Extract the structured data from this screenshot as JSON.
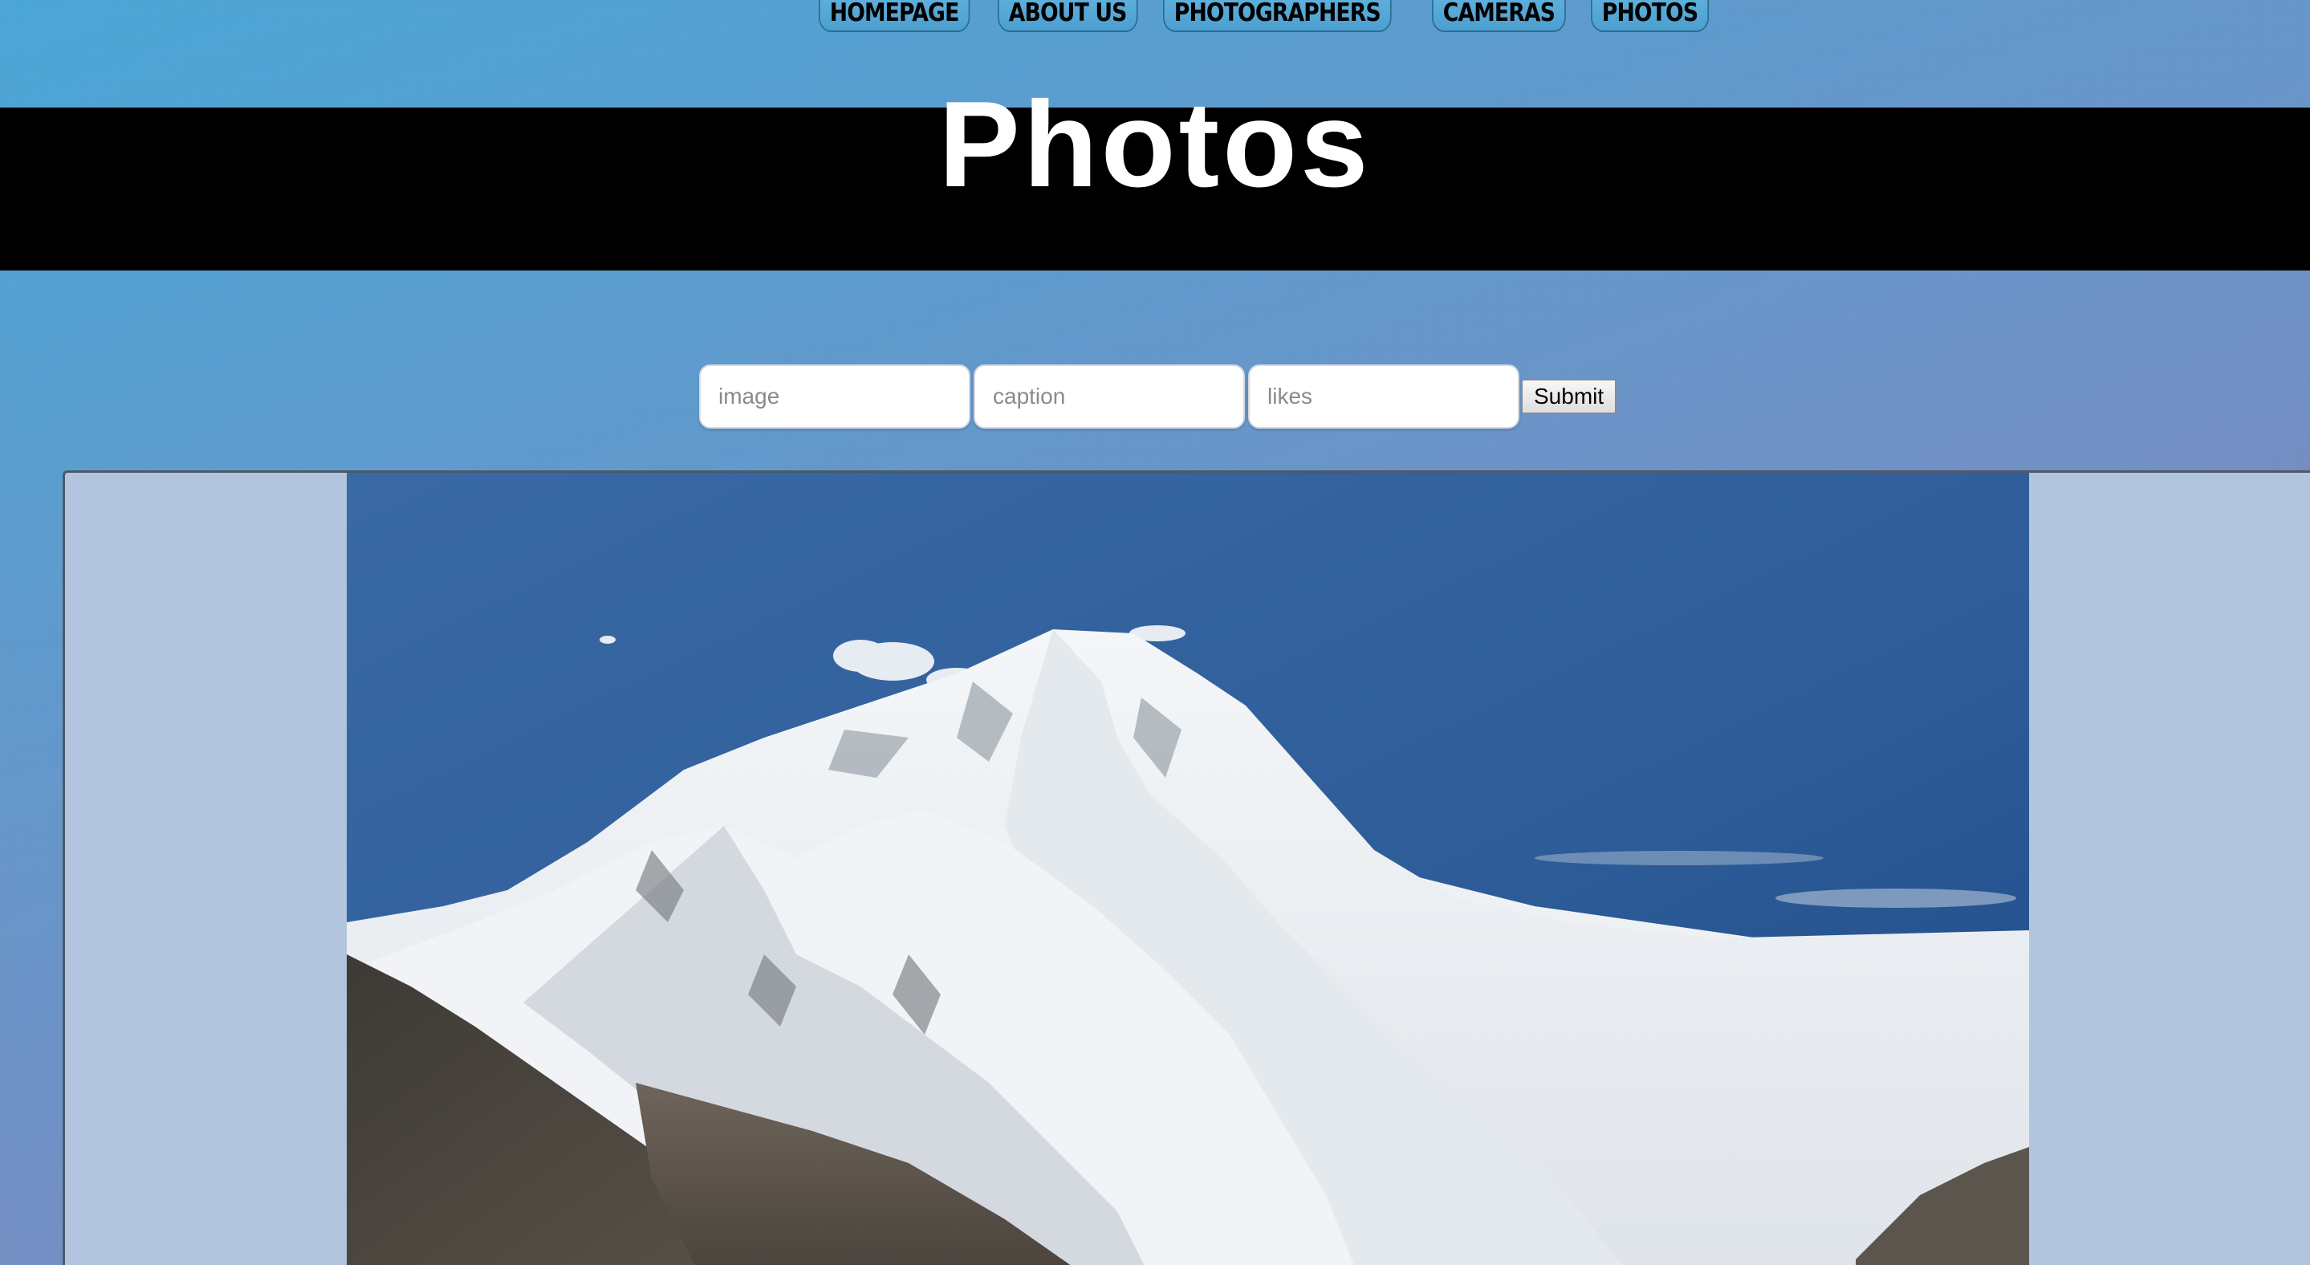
{
  "nav": {
    "items": [
      {
        "label": "HOMEPAGE"
      },
      {
        "label": "ABOUT US"
      },
      {
        "label": "PHOTOGRAPHERS"
      },
      {
        "label": "CAMERAS"
      },
      {
        "label": "PHOTOS"
      }
    ]
  },
  "header": {
    "title": "Photos"
  },
  "form": {
    "image_placeholder": "image",
    "caption_placeholder": "caption",
    "likes_placeholder": "likes",
    "submit_label": "Submit"
  },
  "gallery": {
    "photo_subject": "snow-capped-mountain-photo"
  },
  "colors": {
    "header_bg": "#000000",
    "title_text": "#ffffff",
    "card_bg": "#b3c4de",
    "nav_bg": "#4c9fcf",
    "sky": "#2a5a98"
  }
}
